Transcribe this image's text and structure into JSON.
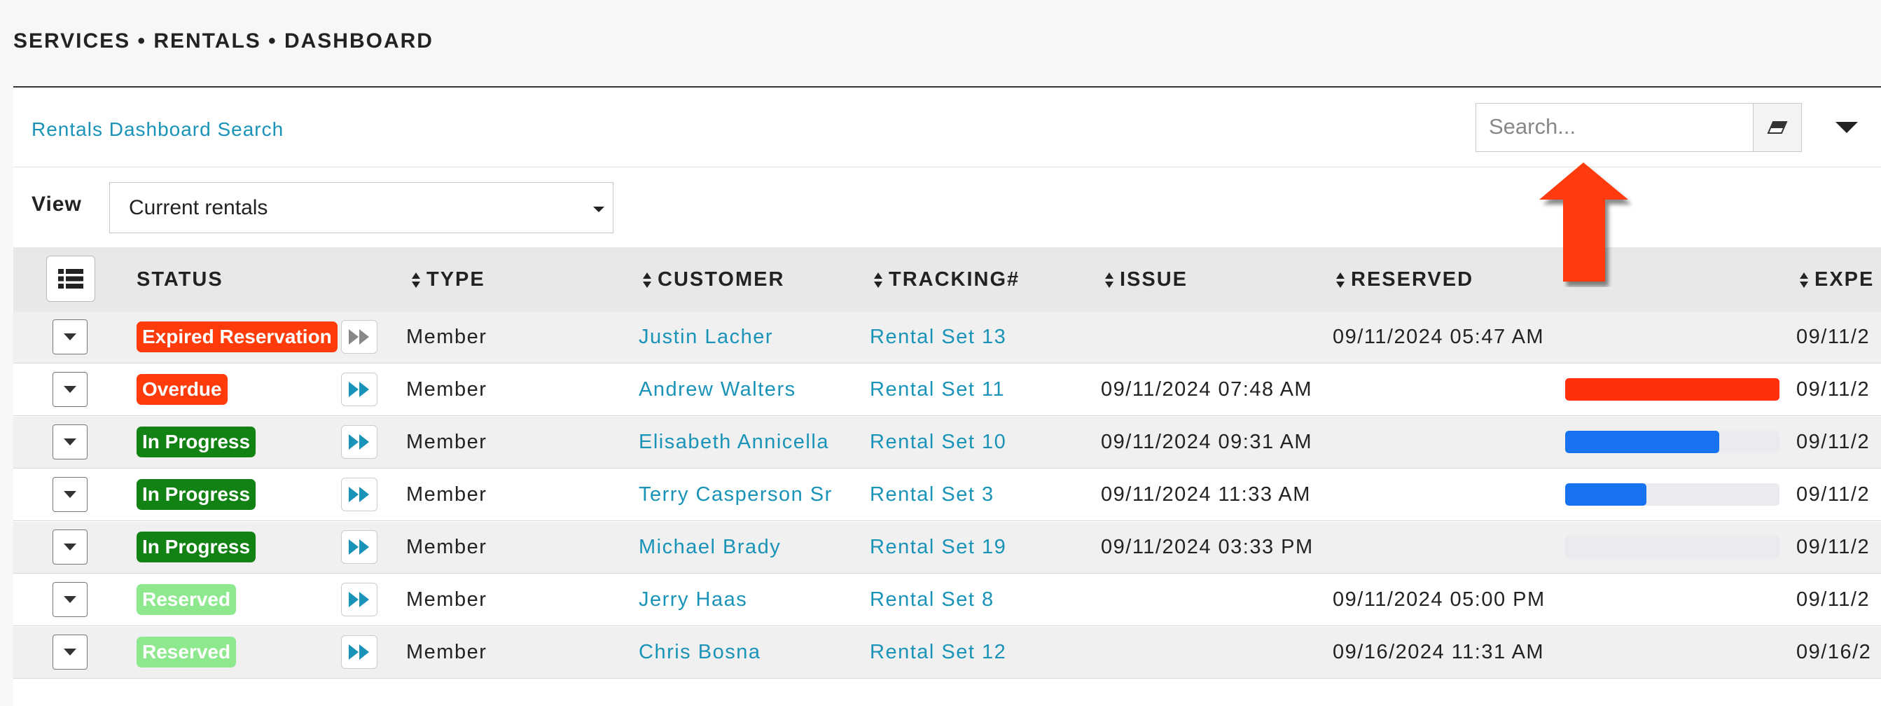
{
  "breadcrumb": "SERVICES • RENTALS • DASHBOARD",
  "panel": {
    "title": "Rentals Dashboard Search"
  },
  "search": {
    "placeholder": "Search..."
  },
  "view": {
    "label": "View",
    "selected": "Current rentals"
  },
  "columns": [
    "STATUS",
    "TYPE",
    "CUSTOMER",
    "TRACKING#",
    "ISSUE",
    "RESERVED",
    "EXPE"
  ],
  "colors": {
    "expired": "#ff3b0a",
    "overdue": "#ff3b0a",
    "in_progress": "#128214",
    "reserved": "#8ee88e",
    "link": "#1a93b8",
    "bar_blue": "#1873f0",
    "bar_red": "#ff2f0a",
    "arrow": "#ff3b0a"
  },
  "rows": [
    {
      "status": "Expired Reservation",
      "status_key": "expired",
      "type": "Member",
      "customer": "Justin Lacher",
      "tracking": "Rental Set 13",
      "issue": "",
      "reserved": "09/11/2024 05:47 AM",
      "progress": null,
      "expected": "09/11/2"
    },
    {
      "status": "Overdue",
      "status_key": "overdue",
      "type": "Member",
      "customer": "Andrew Walters",
      "tracking": "Rental Set 11",
      "issue": "09/11/2024 07:48 AM",
      "reserved": "",
      "progress": 1.0,
      "expected": "09/11/2"
    },
    {
      "status": "In Progress",
      "status_key": "in_progress",
      "type": "Member",
      "customer": "Elisabeth Annicella",
      "tracking": "Rental Set 10",
      "issue": "09/11/2024 09:31 AM",
      "reserved": "",
      "progress": 0.72,
      "expected": "09/11/2"
    },
    {
      "status": "In Progress",
      "status_key": "in_progress",
      "type": "Member",
      "customer": "Terry Casperson Sr",
      "tracking": "Rental Set 3",
      "issue": "09/11/2024 11:33 AM",
      "reserved": "",
      "progress": 0.38,
      "expected": "09/11/2"
    },
    {
      "status": "In Progress",
      "status_key": "in_progress",
      "type": "Member",
      "customer": "Michael Brady",
      "tracking": "Rental Set 19",
      "issue": "09/11/2024 03:33 PM",
      "reserved": "",
      "progress": 0.0,
      "expected": "09/11/2"
    },
    {
      "status": "Reserved",
      "status_key": "reserved",
      "type": "Member",
      "customer": "Jerry Haas",
      "tracking": "Rental Set 8",
      "issue": "",
      "reserved": "09/11/2024 05:00 PM",
      "progress": null,
      "expected": "09/11/2"
    },
    {
      "status": "Reserved",
      "status_key": "reserved",
      "type": "Member",
      "customer": "Chris Bosna",
      "tracking": "Rental Set 12",
      "issue": "",
      "reserved": "09/16/2024 11:31 AM",
      "progress": null,
      "expected": "09/16/2"
    }
  ]
}
